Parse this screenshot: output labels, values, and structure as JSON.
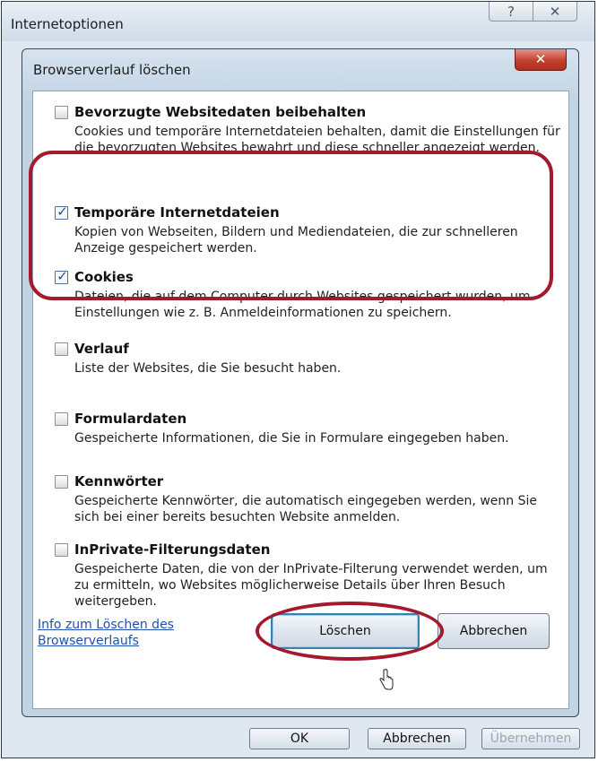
{
  "outer_dialog": {
    "title": "Internetoptionen",
    "help_label": "?",
    "close_label": "✕",
    "buttons": {
      "ok": "OK",
      "cancel": "Abbrechen",
      "apply": "Übernehmen"
    }
  },
  "dialog": {
    "title": "Browserverlauf löschen",
    "close_label": "✕",
    "options": [
      {
        "label": "Bevorzugte Websitedaten beibehalten",
        "checked": false,
        "description": "Cookies und temporäre Internetdateien behalten, damit die Einstellungen für die bevorzugten Websites bewahrt und diese schneller angezeigt werden."
      },
      {
        "label": "Temporäre Internetdateien",
        "checked": true,
        "description": "Kopien von Webseiten, Bildern und Mediendateien, die zur schnelleren Anzeige gespeichert werden."
      },
      {
        "label": "Cookies",
        "checked": true,
        "description": "Dateien, die auf dem Computer durch Websites gespeichert wurden, um Einstellungen wie z. B. Anmeldeinformationen zu speichern."
      },
      {
        "label": "Verlauf",
        "checked": false,
        "description": "Liste der Websites, die Sie besucht haben."
      },
      {
        "label": "Formulardaten",
        "checked": false,
        "description": "Gespeicherte Informationen, die Sie in Formulare eingegeben haben."
      },
      {
        "label": "Kennwörter",
        "checked": false,
        "description": "Gespeicherte Kennwörter, die automatisch eingegeben werden, wenn Sie sich bei einer bereits besuchten Website anmelden."
      },
      {
        "label": "InPrivate-Filterungsdaten",
        "checked": false,
        "description": "Gespeicherte Daten, die von der InPrivate-Filterung verwendet werden, um zu ermitteln, wo Websites möglicherweise Details über Ihren Besuch weitergeben."
      }
    ],
    "help_link": "Info zum Löschen des Browserverlaufs",
    "delete_button": "Löschen",
    "cancel_button": "Abbrechen",
    "check_glyph": "✓"
  },
  "colors": {
    "highlight": "#a3192d",
    "link": "#1f4fb5",
    "close_red": "#c2412d"
  }
}
